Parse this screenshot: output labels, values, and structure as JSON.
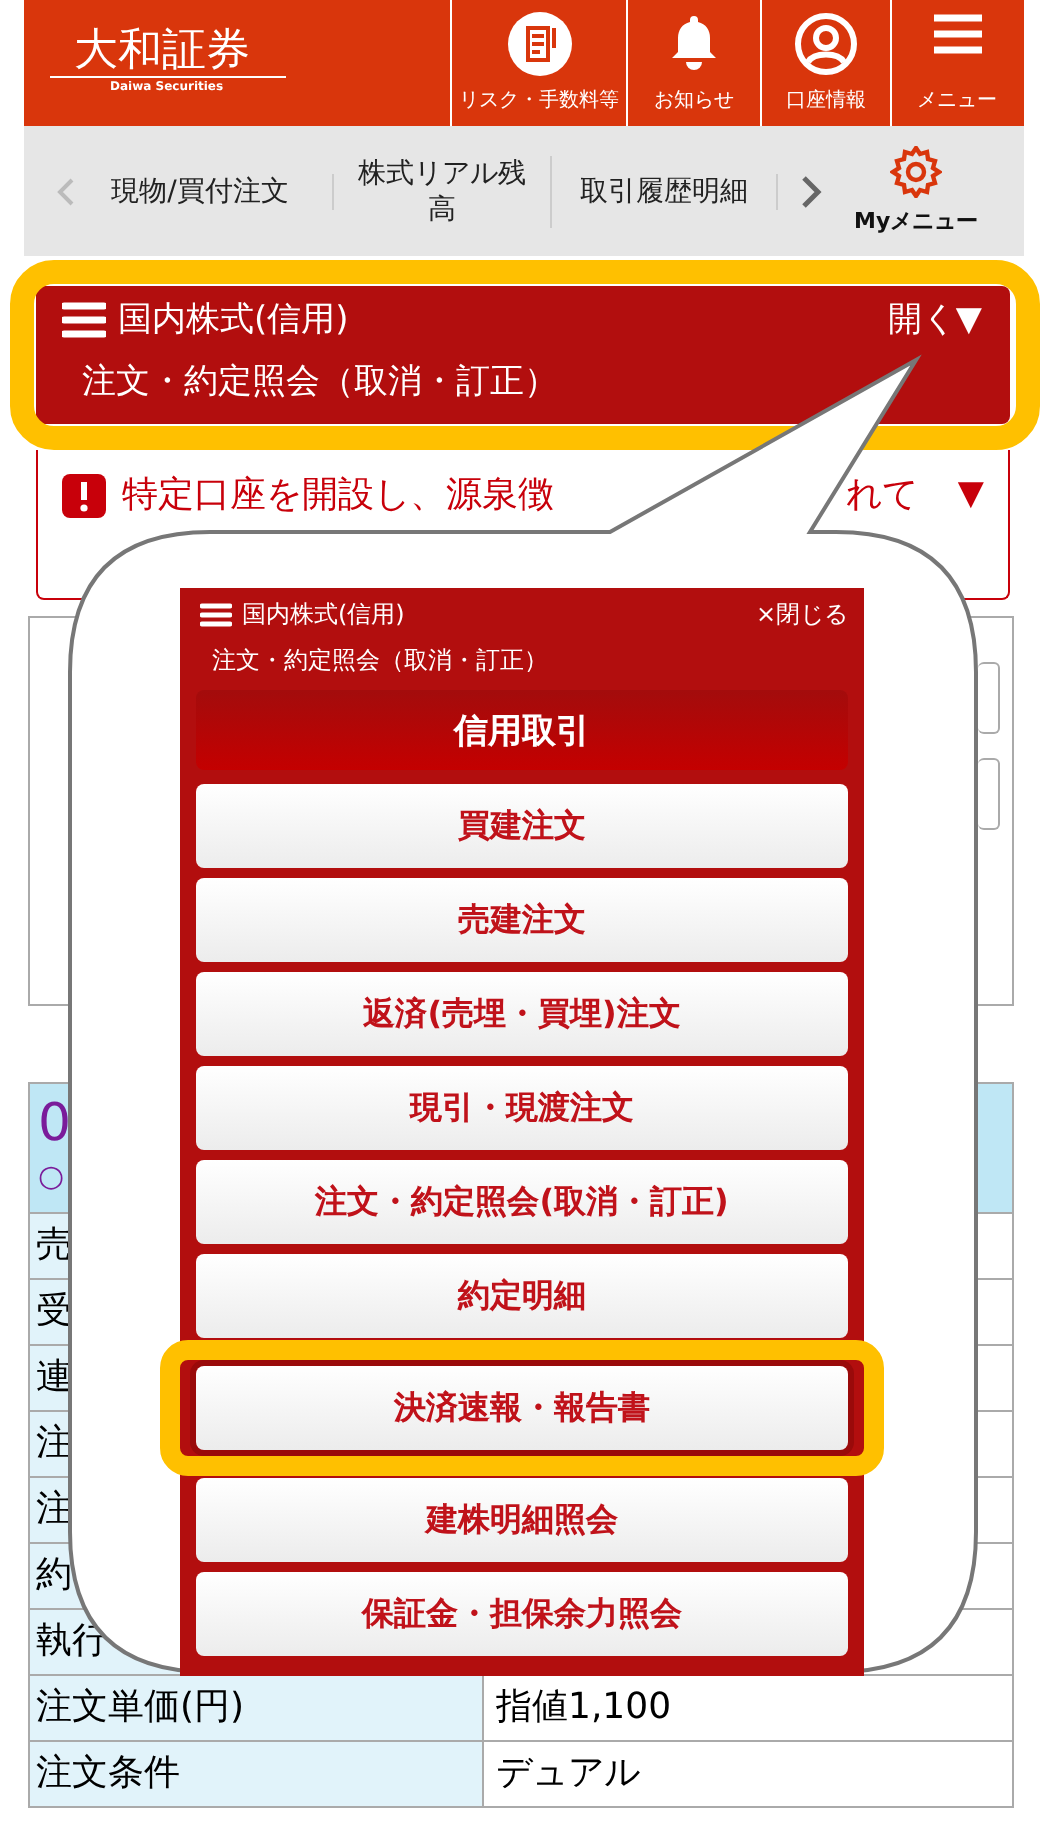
{
  "header": {
    "logo": "大和証券",
    "logo_sub": "Daiwa Securities",
    "buttons": [
      {
        "kind": "document",
        "label": "リスク・手数料等"
      },
      {
        "kind": "bell",
        "label": "お知らせ"
      },
      {
        "kind": "account",
        "label": "口座情報"
      },
      {
        "kind": "menu",
        "label": "メニュー"
      }
    ]
  },
  "nav": {
    "items": [
      "現物/買付注文",
      "株式リアル残高",
      "取引履歴明細"
    ],
    "my_menu": "Myメニュー"
  },
  "panel": {
    "title": "国内株式(信用)",
    "toggle": "開く▼",
    "subtitle": "注文・約定照会（取消・訂正）",
    "highlighted": true
  },
  "notice": {
    "text": "特定口座を開設し、源泉徴",
    "text_end": "れて",
    "toggle": "▼"
  },
  "table": {
    "code": "0",
    "mark": "○",
    "rows": [
      {
        "label": "売"
      },
      {
        "label": "受"
      },
      {
        "label": "連"
      },
      {
        "label": "注"
      },
      {
        "label": "注"
      },
      {
        "label": "約"
      },
      {
        "label": "執行"
      },
      {
        "label": "注文単価(円)",
        "value": "指値1,100"
      },
      {
        "label": "注文条件",
        "value": "デュアル"
      }
    ]
  },
  "callout": {
    "title": "国内株式(信用)",
    "close": "×閉じる",
    "subtitle": "注文・約定照会（取消・訂正）",
    "section": "信用取引",
    "items": [
      {
        "label": "買建注文",
        "highlighted": false
      },
      {
        "label": "売建注文",
        "highlighted": false
      },
      {
        "label": "返済(売埋・買埋)注文",
        "highlighted": false
      },
      {
        "label": "現引・現渡注文",
        "highlighted": false
      },
      {
        "label": "注文・約定照会(取消・訂正)",
        "highlighted": false
      },
      {
        "label": "約定明細",
        "highlighted": false
      },
      {
        "label": "決済速報・報告書",
        "highlighted": true
      },
      {
        "label": "建株明細照会",
        "highlighted": false
      },
      {
        "label": "保証金・担保余力照会",
        "highlighted": false
      }
    ]
  }
}
